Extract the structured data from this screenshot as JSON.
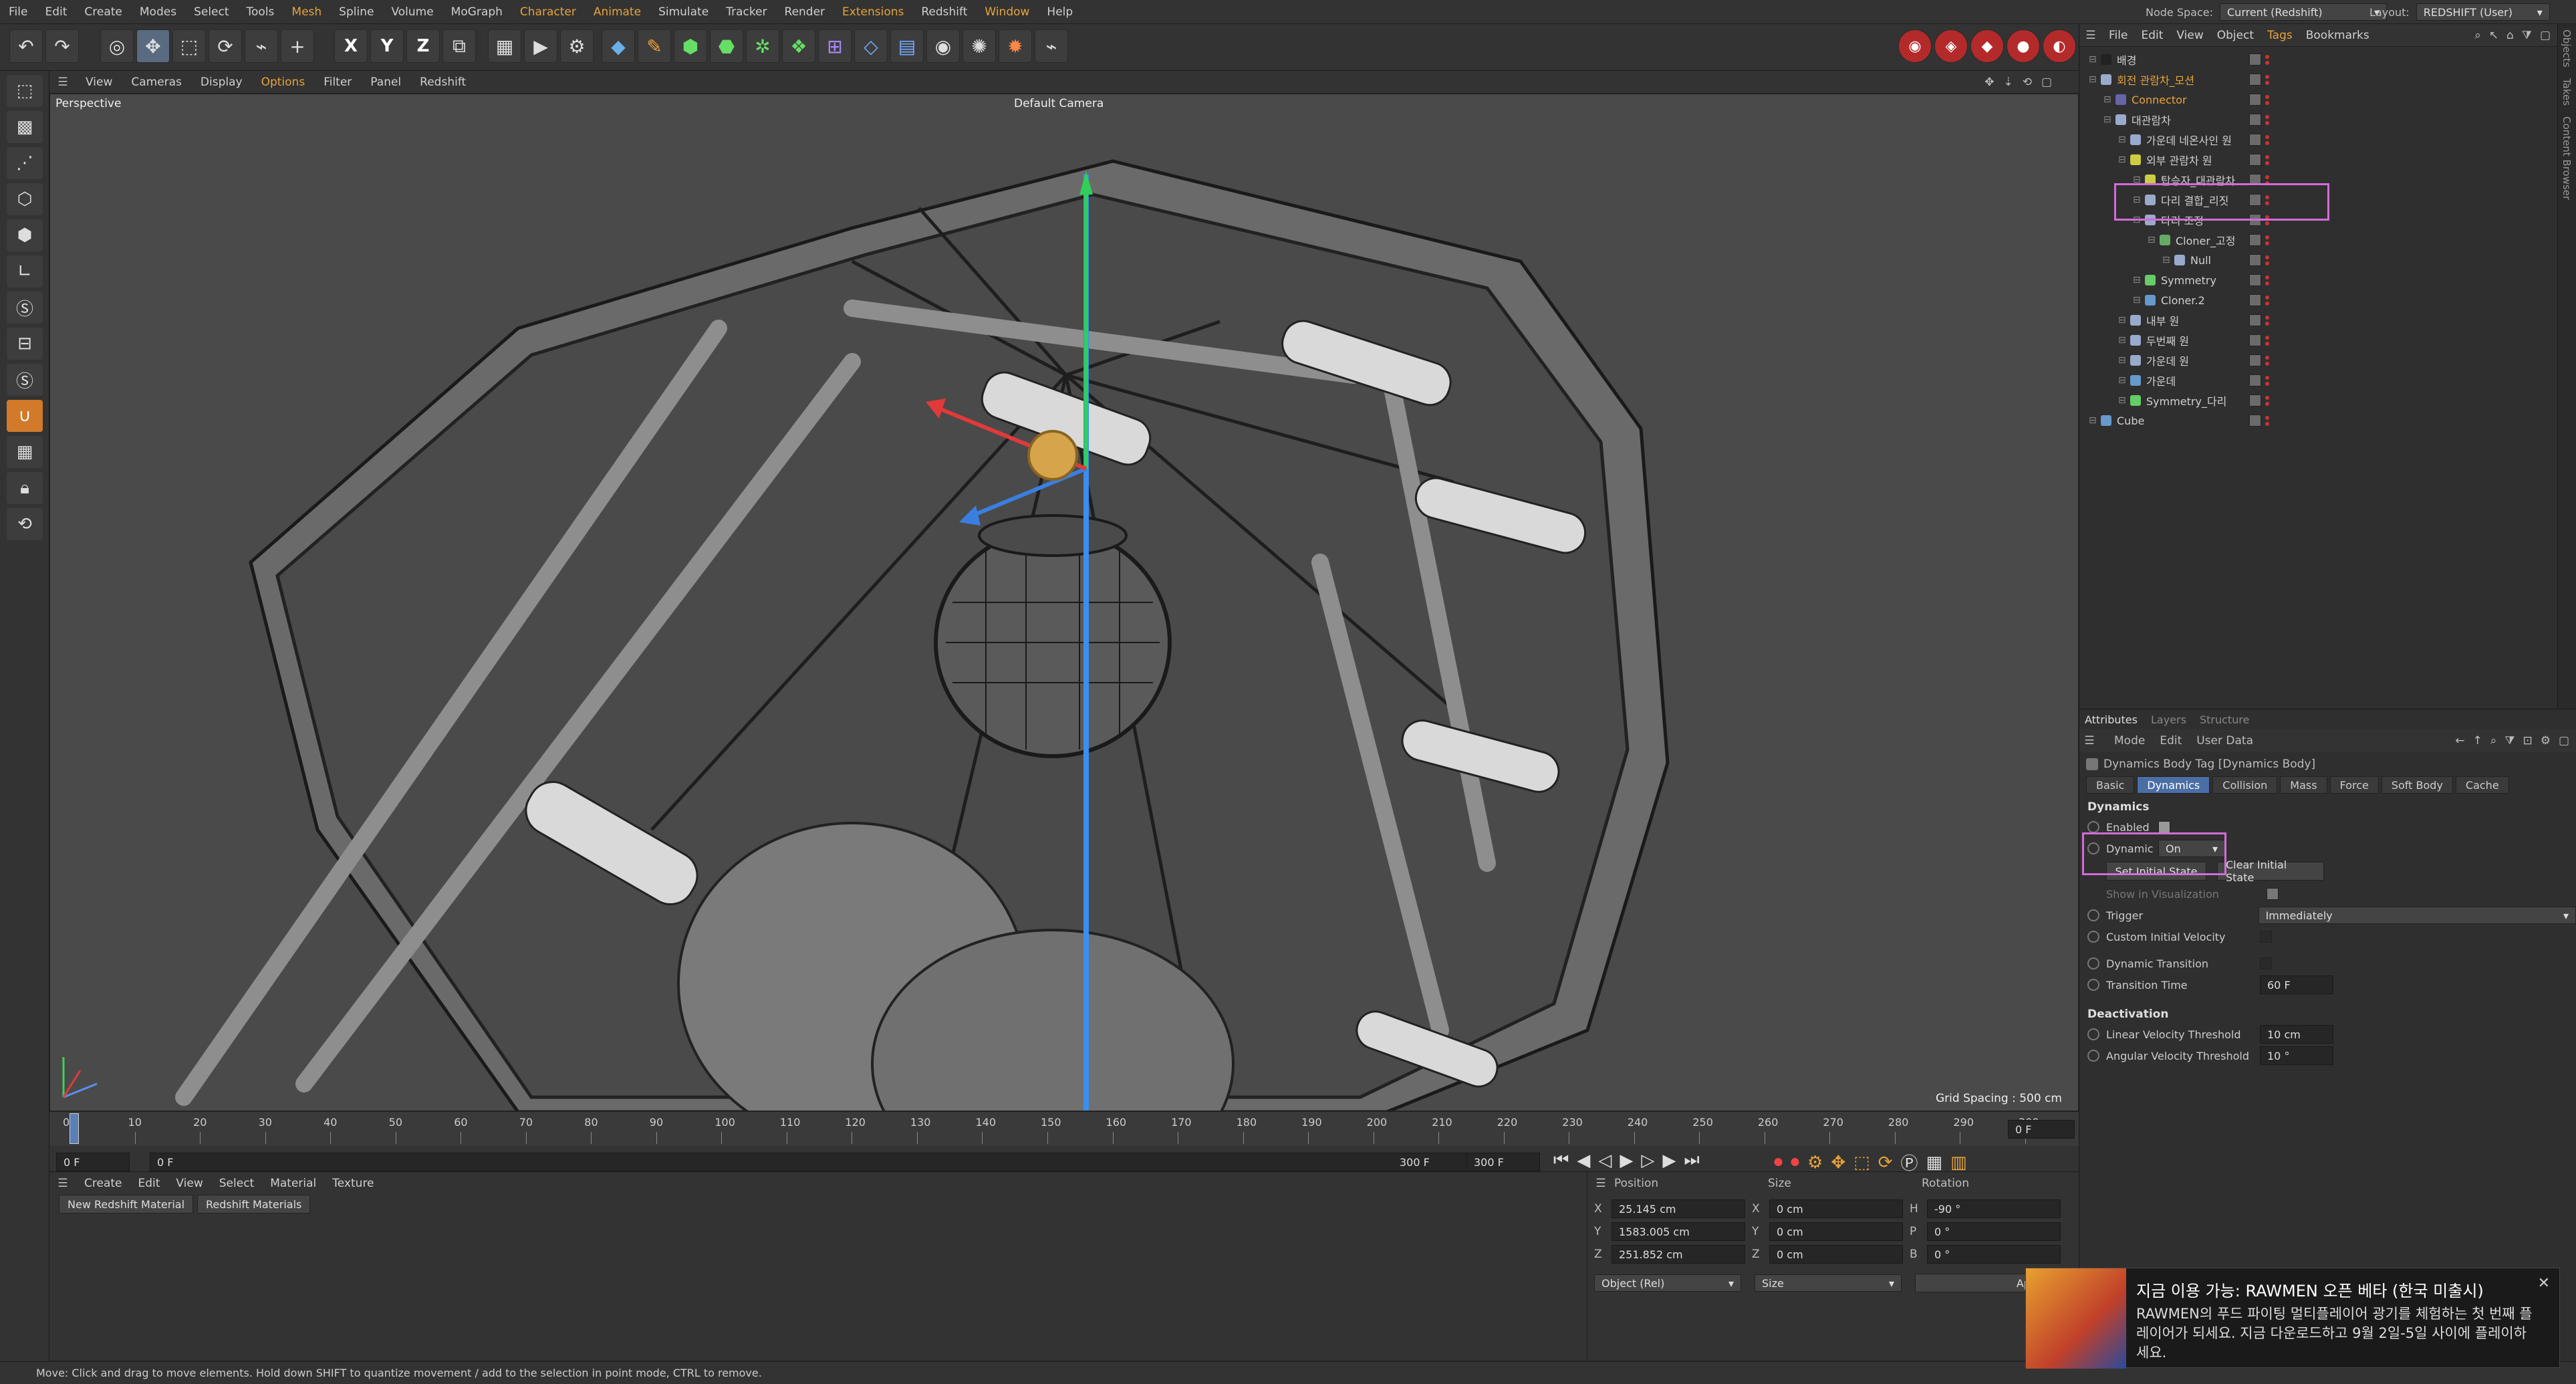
{
  "menu": [
    "File",
    "Edit",
    "Create",
    "Modes",
    "Select",
    "Tools",
    "Mesh",
    "Spline",
    "Volume",
    "MoGraph",
    "Character",
    "Animate",
    "Simulate",
    "Tracker",
    "Render",
    "Extensions",
    "Redshift",
    "Window",
    "Help"
  ],
  "menu_accent": [
    "Mesh",
    "Character",
    "Animate",
    "Extensions",
    "Window"
  ],
  "node_space": {
    "label": "Node Space:",
    "value": "Current (Redshift)"
  },
  "layout": {
    "label": "Layout:",
    "value": "REDSHIFT (User)"
  },
  "toolbar": {
    "axis": [
      "X",
      "Y",
      "Z"
    ]
  },
  "viewport": {
    "menu": [
      "View",
      "Cameras",
      "Display",
      "Options",
      "Filter",
      "Panel",
      "Redshift"
    ],
    "menu_accent": [
      "Options"
    ],
    "view_name": "Perspective",
    "camera": "Default Camera",
    "grid_spacing": "Grid Spacing : 500 cm"
  },
  "timeline": {
    "ticks": [
      "0",
      "10",
      "20",
      "30",
      "40",
      "50",
      "60",
      "70",
      "80",
      "90",
      "100",
      "110",
      "120",
      "130",
      "140",
      "150",
      "160",
      "170",
      "180",
      "190",
      "200",
      "210",
      "220",
      "230",
      "240",
      "250",
      "260",
      "270",
      "280",
      "290",
      "300"
    ],
    "current_frame": "0 F",
    "start": "0 F",
    "start2": "0 F",
    "end": "300 F",
    "end2": "300 F"
  },
  "material_manager": {
    "menu": [
      "Create",
      "Edit",
      "View",
      "Select",
      "Material",
      "Texture"
    ],
    "buttons": [
      "New Redshift Material",
      "Redshift Materials"
    ]
  },
  "coords": {
    "headers": [
      "Position",
      "Size",
      "Rotation"
    ],
    "position": [
      {
        "axis": "X",
        "value": "25.145 cm"
      },
      {
        "axis": "Y",
        "value": "1583.005 cm"
      },
      {
        "axis": "Z",
        "value": "251.852 cm"
      }
    ],
    "size": [
      {
        "axis": "X",
        "value": "0 cm"
      },
      {
        "axis": "Y",
        "value": "0 cm"
      },
      {
        "axis": "Z",
        "value": "0 cm"
      }
    ],
    "rotation": [
      {
        "axis": "H",
        "value": "-90 °"
      },
      {
        "axis": "P",
        "value": "0 °"
      },
      {
        "axis": "B",
        "value": "0 °"
      }
    ],
    "mode": "Object (Rel)",
    "size_mode": "Size",
    "apply": "Apply"
  },
  "object_manager": {
    "menu": [
      "File",
      "Edit",
      "View",
      "Object",
      "Tags",
      "Bookmarks"
    ],
    "menu_accent": [
      "Tags"
    ],
    "objects": [
      {
        "name": "배경",
        "indent": 0,
        "hl": false,
        "icon": "#222"
      },
      {
        "name": "회전 관람차_모션",
        "indent": 0,
        "hl": true,
        "icon": "#9ac"
      },
      {
        "name": "Connector",
        "indent": 1,
        "hl": true,
        "icon": "#66a"
      },
      {
        "name": "대관람차",
        "indent": 1,
        "hl": false,
        "icon": "#9ac"
      },
      {
        "name": "가운데 네온사인 원",
        "indent": 2,
        "hl": false,
        "icon": "#9ac"
      },
      {
        "name": "외부 관람차 원",
        "indent": 2,
        "hl": false,
        "icon": "#cc4"
      },
      {
        "name": "탑승자_대관람차",
        "indent": 3,
        "hl": false,
        "icon": "#cc4"
      },
      {
        "name": "다리 결합_리짓",
        "indent": 3,
        "hl": false,
        "icon": "#9ac"
      },
      {
        "name": "다리 조정",
        "indent": 3,
        "hl": false,
        "icon": "#9ac"
      },
      {
        "name": "Cloner_고정",
        "indent": 4,
        "hl": false,
        "icon": "#6a6"
      },
      {
        "name": "Null",
        "indent": 5,
        "hl": false,
        "icon": "#9ac"
      },
      {
        "name": "Symmetry",
        "indent": 3,
        "hl": false,
        "icon": "#6c6"
      },
      {
        "name": "Cloner.2",
        "indent": 3,
        "hl": false,
        "icon": "#69c"
      },
      {
        "name": "내부 원",
        "indent": 2,
        "hl": false,
        "icon": "#9ac"
      },
      {
        "name": "두번째 원",
        "indent": 2,
        "hl": false,
        "icon": "#9ac"
      },
      {
        "name": "가운데 원",
        "indent": 2,
        "hl": false,
        "icon": "#9ac"
      },
      {
        "name": "가운데",
        "indent": 2,
        "hl": false,
        "icon": "#69c"
      },
      {
        "name": "Symmetry_다리",
        "indent": 2,
        "hl": false,
        "icon": "#6c6"
      },
      {
        "name": "Cube",
        "indent": 0,
        "hl": false,
        "icon": "#69c"
      }
    ]
  },
  "side_tabs": [
    "Objects",
    "Takes",
    "Content Browser"
  ],
  "attributes": {
    "tabs_top": [
      "Attributes",
      "Layers",
      "Structure"
    ],
    "menu": [
      "Mode",
      "Edit",
      "User Data"
    ],
    "title": "Dynamics Body Tag [Dynamics Body]",
    "tabs": [
      "Basic",
      "Dynamics",
      "Collision",
      "Mass",
      "Force",
      "Soft Body",
      "Cache"
    ],
    "active_tab": "Dynamics",
    "section_dynamics": "Dynamics",
    "enabled_label": "Enabled",
    "dynamic_label": "Dynamic",
    "dynamic_value": "On",
    "set_initial": "Set Initial State",
    "clear_initial": "Clear Initial State",
    "show_in_vis": "Show in Visualization",
    "trigger_label": "Trigger",
    "trigger_value": "Immediately",
    "custom_vel": "Custom Initial Velocity",
    "dyn_transition": "Dynamic Transition",
    "transition_time_label": "Transition Time",
    "transition_time": "60 F",
    "section_deactivation": "Deactivation",
    "linear_label": "Linear Velocity Threshold",
    "linear_value": "10 cm",
    "angular_label": "Angular Velocity Threshold",
    "angular_value": "10 °"
  },
  "status": "Move: Click and drag to move elements. Hold down SHIFT to quantize movement / add to the selection in point mode, CTRL to remove.",
  "notification": {
    "title": "지금 이용 가능: RAWMEN 오픈 베타 (한국 미출시)",
    "body": "RAWMEN의 푸드 파이팅 멀티플레이어 광기를 체험하는 첫 번째 플레이어가 되세요. 지금 다운로드하고 9월 2일-5일 사이에 플레이하세요.",
    "close": "✕"
  },
  "colors": {
    "accent": "#e7a33a",
    "highlight": "#d26bd9",
    "active_tab": "#4a6fa5"
  }
}
